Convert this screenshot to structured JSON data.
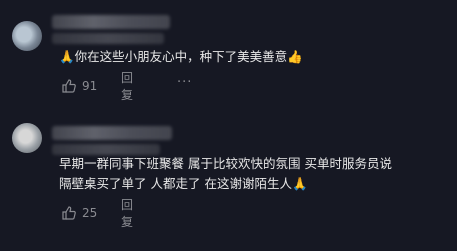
{
  "comments": [
    {
      "text": "🙏你在这些小朋友心中，种下了美美善意👍",
      "likes": "91",
      "reply_label": "回复",
      "more_label": "···"
    },
    {
      "text": "早期一群同事下班聚餐 属于比较欢快的氛围 买单时服务员说\n隔壁桌买了单了 人都走了 在这谢谢陌生人🙏",
      "likes": "25",
      "reply_label": "回复"
    }
  ]
}
